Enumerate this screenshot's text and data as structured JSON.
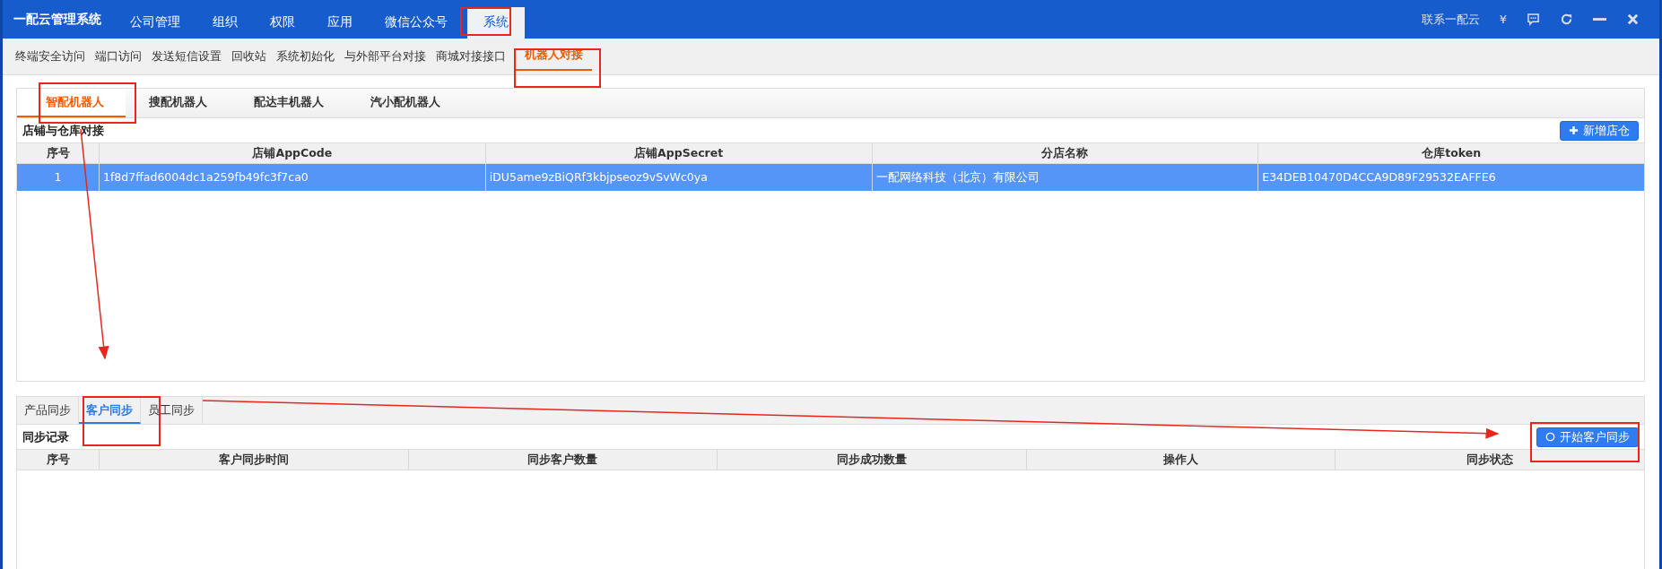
{
  "app": {
    "title": "一配云管理系统"
  },
  "top_menu": [
    {
      "label": "公司管理",
      "selected": false
    },
    {
      "label": "组织",
      "selected": false
    },
    {
      "label": "权限",
      "selected": false
    },
    {
      "label": "应用",
      "selected": false
    },
    {
      "label": "微信公众号",
      "selected": false
    },
    {
      "label": "系统",
      "selected": true
    }
  ],
  "header_actions": {
    "contact": "联系一配云",
    "currency": "¥"
  },
  "sub_nav": [
    {
      "label": "终端安全访问",
      "selected": false
    },
    {
      "label": "端口访问",
      "selected": false
    },
    {
      "label": "发送短信设置",
      "selected": false
    },
    {
      "label": "回收站",
      "selected": false
    },
    {
      "label": "系统初始化",
      "selected": false
    },
    {
      "label": "与外部平台对接",
      "selected": false
    },
    {
      "label": "商城对接接口",
      "selected": false
    },
    {
      "label": "机器人对接",
      "selected": true
    }
  ],
  "robot_tabs": [
    {
      "label": "智配机器人",
      "selected": true
    },
    {
      "label": "搜配机器人",
      "selected": false
    },
    {
      "label": "配达丰机器人",
      "selected": false
    },
    {
      "label": "汽小配机器人",
      "selected": false
    }
  ],
  "store_panel": {
    "title": "店铺与仓库对接",
    "add_button": "新增店仓",
    "table": {
      "columns": [
        "序号",
        "店铺AppCode",
        "店铺AppSecret",
        "分店名称",
        "仓库token"
      ],
      "rows": [
        {
          "cells": [
            "1",
            "1f8d7ffad6004dc1a259fb49fc3f7ca0",
            "iDU5ame9zBiQRf3kbjpseoz9vSvWc0ya",
            "一配网络科技（北京）有限公司",
            "E34DEB10470D4CCA9D89F29532EAFFE6"
          ],
          "selected": true
        }
      ]
    }
  },
  "sync_tabs": [
    {
      "label": "产品同步",
      "selected": false
    },
    {
      "label": "客户同步",
      "selected": true
    },
    {
      "label": "员工同步",
      "selected": false
    }
  ],
  "sync_panel": {
    "title": "同步记录",
    "start_button": "开始客户同步",
    "table": {
      "columns": [
        "序号",
        "客户同步时间",
        "同步客户数量",
        "同步成功数量",
        "操作人",
        "同步状态"
      ]
    }
  }
}
